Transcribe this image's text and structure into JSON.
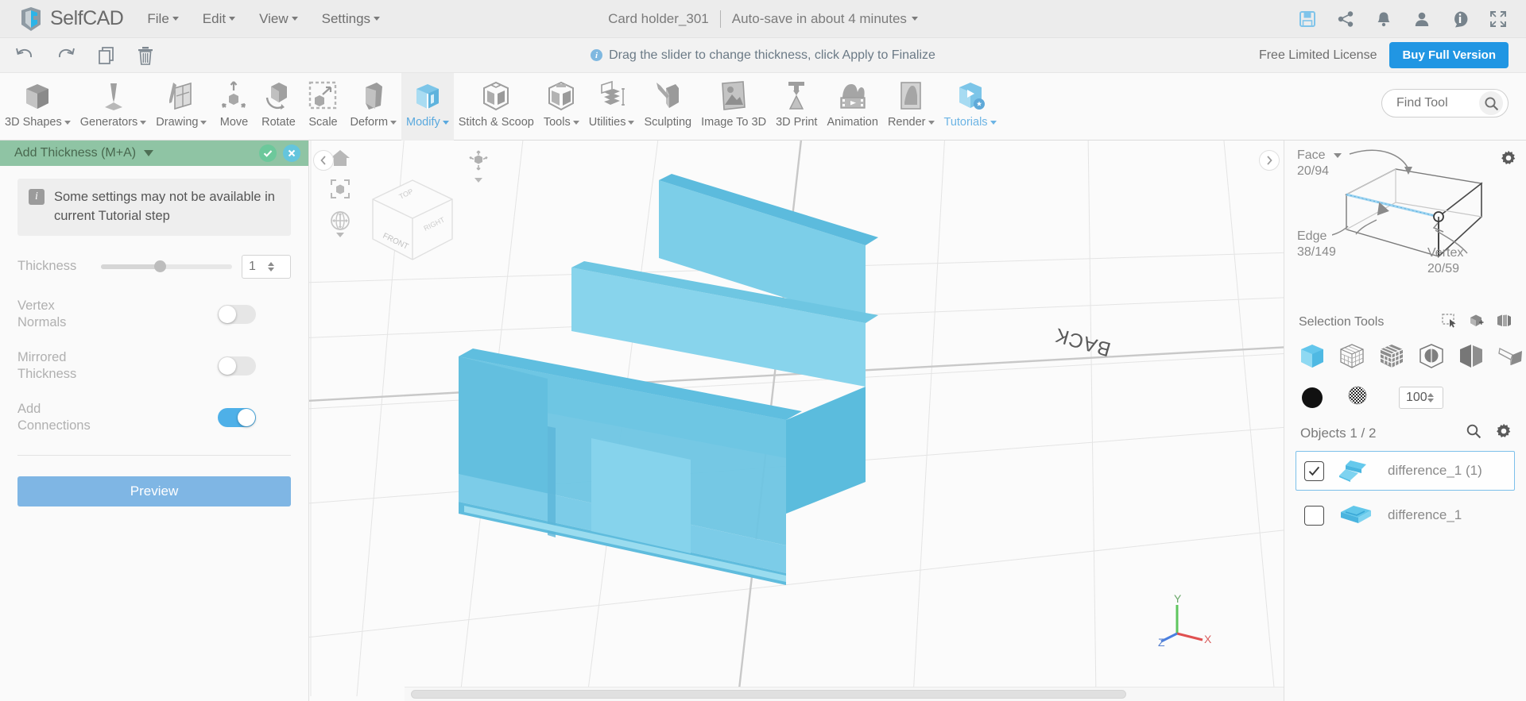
{
  "app": {
    "brand": "SelfCAD",
    "menus": [
      {
        "label": "File",
        "has_caret": true
      },
      {
        "label": "Edit",
        "has_caret": true
      },
      {
        "label": "View",
        "has_caret": true
      },
      {
        "label": "Settings",
        "has_caret": true
      }
    ],
    "document_title": "Card holder_301",
    "autosave_text": "Auto-save in about 4 minutes",
    "top_icons": [
      {
        "name": "save-icon"
      },
      {
        "name": "share-icon"
      },
      {
        "name": "notifications-bell-icon"
      },
      {
        "name": "user-account-icon"
      },
      {
        "name": "info-icon"
      },
      {
        "name": "fullscreen-icon"
      }
    ]
  },
  "secondbar": {
    "history_icons": [
      {
        "name": "undo-icon"
      },
      {
        "name": "redo-icon"
      },
      {
        "name": "copy-icon"
      },
      {
        "name": "delete-trash-icon"
      }
    ],
    "notice": "Drag the slider to change thickness, click Apply to Finalize",
    "license_text": "Free Limited License",
    "buy_button": "Buy Full Version"
  },
  "ribbon": {
    "items": [
      {
        "label": "3D Shapes",
        "icon": "cube-icon",
        "caret": true,
        "active": false
      },
      {
        "label": "Generators",
        "icon": "generator-icon",
        "caret": true,
        "active": false
      },
      {
        "label": "Drawing",
        "icon": "drawing-icon",
        "caret": true,
        "active": false
      },
      {
        "label": "Move",
        "icon": "move-icon",
        "caret": false,
        "active": false
      },
      {
        "label": "Rotate",
        "icon": "rotate-icon",
        "caret": false,
        "active": false
      },
      {
        "label": "Scale",
        "icon": "scale-icon",
        "caret": false,
        "active": false
      },
      {
        "label": "Deform",
        "icon": "deform-icon",
        "caret": true,
        "active": false
      },
      {
        "label": "Modify",
        "icon": "modify-icon",
        "caret": true,
        "active": true
      },
      {
        "label": "Stitch & Scoop",
        "icon": "stitch-scoop-icon",
        "caret": false,
        "active": false
      },
      {
        "label": "Tools",
        "icon": "tools-icon",
        "caret": true,
        "active": false
      },
      {
        "label": "Utilities",
        "icon": "utilities-icon",
        "caret": true,
        "active": false
      },
      {
        "label": "Sculpting",
        "icon": "sculpting-icon",
        "caret": false,
        "active": false
      },
      {
        "label": "Image To 3D",
        "icon": "image-to-3d-icon",
        "caret": false,
        "active": false
      },
      {
        "label": "3D Print",
        "icon": "3d-print-icon",
        "caret": false,
        "active": false
      },
      {
        "label": "Animation",
        "icon": "animation-icon",
        "caret": false,
        "active": false
      },
      {
        "label": "Render",
        "icon": "render-icon",
        "caret": true,
        "active": false
      },
      {
        "label": "Tutorials",
        "icon": "tutorials-icon",
        "caret": true,
        "active": false
      }
    ],
    "find_tool_placeholder": "Find Tool"
  },
  "left_panel": {
    "title": "Add Thickness (M+A)",
    "confirm_icon": "check-icon",
    "cancel_icon": "close-icon",
    "warning": "Some settings may not be available in current Tutorial step",
    "fields": [
      {
        "label": "Thickness",
        "type": "slider",
        "value": "1",
        "slider_percent": 45
      },
      {
        "label": "Vertex Normals",
        "type": "toggle",
        "on": false
      },
      {
        "label": "Mirrored Thickness",
        "type": "toggle",
        "on": false
      },
      {
        "label": "Add Connections",
        "type": "toggle",
        "on": true
      }
    ],
    "preview_button": "Preview"
  },
  "viewport": {
    "nav_cube_faces": {
      "top": "TOP",
      "front": "FRONT",
      "right": "RIGHT"
    },
    "scene_label": "BACK",
    "left_tools": [
      {
        "name": "home-view-icon"
      },
      {
        "name": "fit-to-view-icon"
      },
      {
        "name": "orbit-navigation-icon"
      }
    ],
    "mid_tool": {
      "name": "view-orientation-icon"
    },
    "axis": {
      "x": "X",
      "y": "Y",
      "z": "Z"
    },
    "collapse_left_icon": "chevron-left-icon",
    "collapse_right_icon": "chevron-right-icon"
  },
  "right_panel": {
    "topology": {
      "face_label": "Face",
      "face_value": "20/94",
      "edge_label": "Edge",
      "edge_value": "38/149",
      "vertex_label": "Vertex",
      "vertex_value": "20/59"
    },
    "selection_tools_label": "Selection Tools",
    "selection_mode_icons": [
      {
        "name": "rectangle-select-icon"
      },
      {
        "name": "box-select-icon"
      },
      {
        "name": "paint-select-icon"
      }
    ],
    "selection_type_icons": [
      {
        "name": "object-select-icon",
        "active": true
      },
      {
        "name": "wireframe-select-icon",
        "active": false
      },
      {
        "name": "face-select-icon",
        "active": false
      },
      {
        "name": "sphere-select-icon",
        "active": false
      },
      {
        "name": "half-select-icon",
        "active": false
      },
      {
        "name": "polygon-select-icon",
        "active": false
      }
    ],
    "material_color": "#111111",
    "texture_icon": "texture-sphere-icon",
    "opacity_value": "100",
    "objects_label": "Objects 1 / 2",
    "objects_actions": [
      {
        "name": "search-objects-icon"
      },
      {
        "name": "objects-settings-gear-icon"
      }
    ],
    "objects": [
      {
        "name": "difference_1 (1)",
        "checked": true,
        "selected": true
      },
      {
        "name": "difference_1",
        "checked": false,
        "selected": false
      }
    ],
    "gear_icon": "gear-icon"
  },
  "colors": {
    "accent_blue": "#2196e3",
    "panel_header_green": "#8fc4a4",
    "model_cyan": "#4ec4e8",
    "toggle_on": "#4eb0e8",
    "preview_button": "#7fb6e4"
  }
}
